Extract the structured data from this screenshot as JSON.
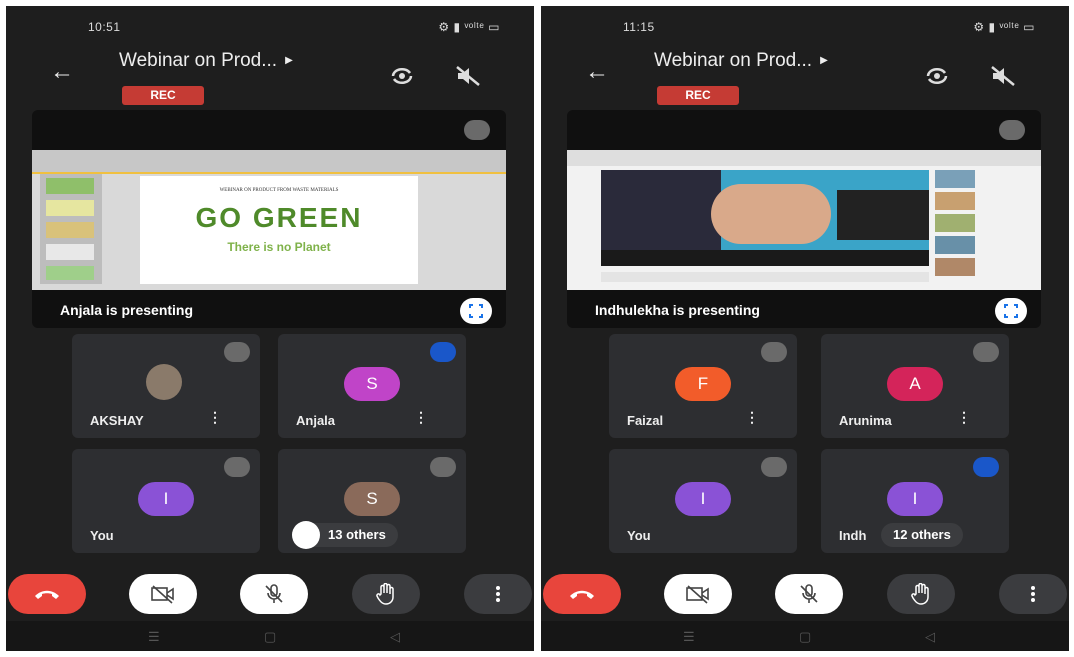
{
  "left": {
    "status": {
      "time": "10:51",
      "icons": "⚙ ▮ ᵛᵒˡᵗᵉ ▭"
    },
    "meeting_title": "Webinar on Prod...",
    "rec_label": "REC",
    "presenting_label": "Anjala  is presenting",
    "slide_heading": "WEBINAR ON PRODUCT FROM WASTE MATERIALS",
    "slide_big": "GO GREEN",
    "slide_sub": "There is no Planet",
    "tiles": [
      {
        "name": "AKSHAY",
        "initial": "",
        "avatar_color": "#8a7a6a"
      },
      {
        "name": "Anjala",
        "initial": "S",
        "avatar_color": "#c044c8"
      },
      {
        "name": "You",
        "initial": "I",
        "avatar_color": "#8a52d6"
      },
      {
        "name": "",
        "initial": "S",
        "avatar_color": "#8a6a5a"
      }
    ],
    "others_label": "13 others"
  },
  "right": {
    "status": {
      "time": "11:15",
      "icons": "⚙ ▮ ᵛᵒˡᵗᵉ ▭"
    },
    "meeting_title": "Webinar on Prod...",
    "rec_label": "REC",
    "presenting_label": "Indhulekha is presenting",
    "tiles": [
      {
        "name": "Faizal",
        "initial": "F",
        "avatar_color": "#f25c2a"
      },
      {
        "name": "Arunima",
        "initial": "A",
        "avatar_color": "#d4245a"
      },
      {
        "name": "You",
        "initial": "I",
        "avatar_color": "#8a52d6"
      },
      {
        "name": "Indh",
        "initial": "I",
        "avatar_color": "#8a52d6"
      }
    ],
    "others_label": "12 others"
  },
  "colors": {
    "end_call": "#e8453c",
    "rec": "#c53b34",
    "speaking": "#1a57c9",
    "bg": "#1e1e1e",
    "tile": "#2d2e31"
  }
}
